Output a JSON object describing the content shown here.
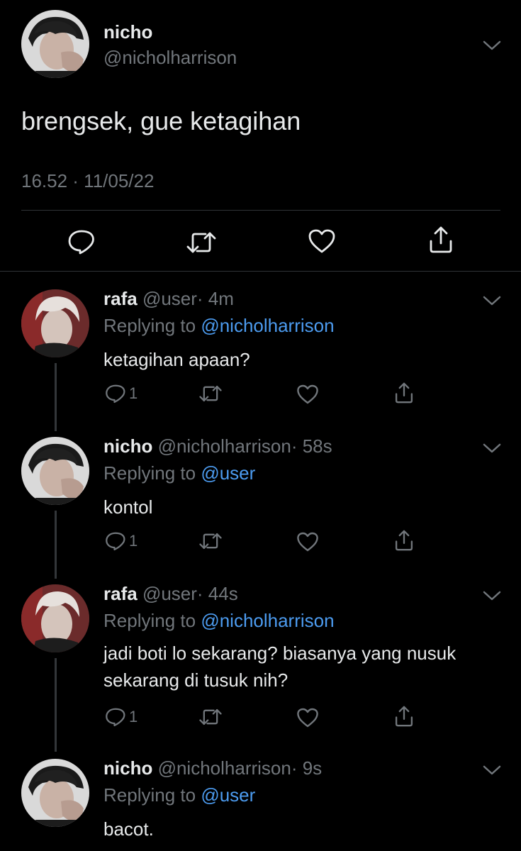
{
  "main_tweet": {
    "name": "nicho",
    "handle": "@nicholharrison",
    "text": "brengsek, gue ketagihan",
    "timestamp": "16.52 · 11/05/22",
    "actions": [
      "reply-icon",
      "retweet-icon",
      "like-icon",
      "share-icon"
    ]
  },
  "replies": [
    {
      "name": "rafa",
      "handle": "@user",
      "time": "· 4m",
      "replying_label": "Replying to",
      "replying_to": "@nicholharrison",
      "text": "ketagihan apaan?",
      "reply_count": "1"
    },
    {
      "name": "nicho",
      "handle": "@nicholharrison",
      "time": "· 58s",
      "replying_label": "Replying to",
      "replying_to": "@user",
      "text": "kontol",
      "reply_count": "1"
    },
    {
      "name": "rafa",
      "handle": "@user",
      "time": "· 44s",
      "replying_label": "Replying to",
      "replying_to": "@nicholharrison",
      "text": "jadi boti lo sekarang? biasanya yang nusuk sekarang di tusuk nih?",
      "reply_count": "1"
    },
    {
      "name": "nicho",
      "handle": "@nicholharrison",
      "time": "· 9s",
      "replying_label": "Replying to",
      "replying_to": "@user",
      "text": "bacot."
    }
  ],
  "colors": {
    "background": "#000000",
    "text_primary": "#e7e9ea",
    "text_secondary": "#71767b",
    "mention": "#4c9bef"
  }
}
